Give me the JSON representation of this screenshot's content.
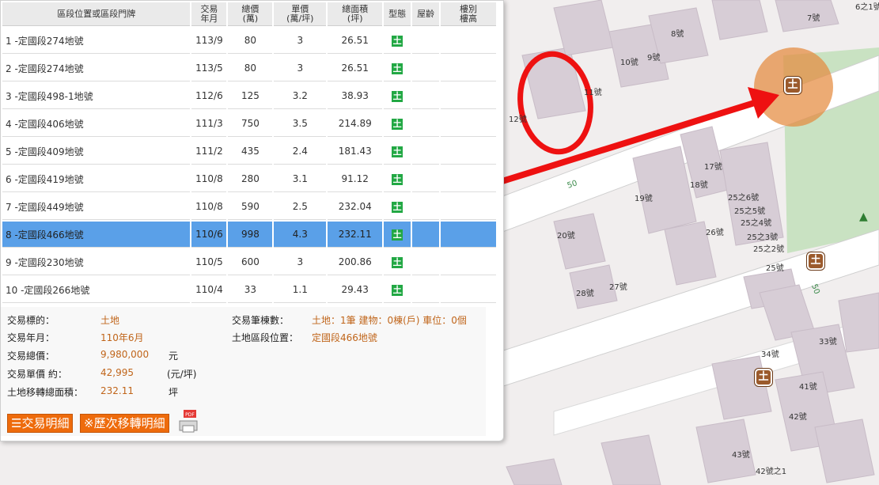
{
  "table": {
    "headers": {
      "addr": "區段位置或區段門牌",
      "date_l1": "交易",
      "date_l2": "年月",
      "price_l1": "總價",
      "price_l2": "(萬)",
      "unit_l1": "單價",
      "unit_l2": "(萬/坪)",
      "area_l1": "總面積",
      "area_l2": "(坪)",
      "type": "型態",
      "age": "屋齡",
      "floor_l1": "樓別",
      "floor_l2": "樓高"
    },
    "type_icon_glyph": "土",
    "rows": [
      {
        "addr": "1 -定國段274地號",
        "date": "113/9",
        "price": "80",
        "unit": "3",
        "area": "26.51"
      },
      {
        "addr": "2 -定國段274地號",
        "date": "113/5",
        "price": "80",
        "unit": "3",
        "area": "26.51"
      },
      {
        "addr": "3 -定國段498-1地號",
        "date": "112/6",
        "price": "125",
        "unit": "3.2",
        "area": "38.93"
      },
      {
        "addr": "4 -定國段406地號",
        "date": "111/3",
        "price": "750",
        "unit": "3.5",
        "area": "214.89"
      },
      {
        "addr": "5 -定國段409地號",
        "date": "111/2",
        "price": "435",
        "unit": "2.4",
        "area": "181.43"
      },
      {
        "addr": "6 -定國段419地號",
        "date": "110/8",
        "price": "280",
        "unit": "3.1",
        "area": "91.12"
      },
      {
        "addr": "7 -定國段449地號",
        "date": "110/8",
        "price": "590",
        "unit": "2.5",
        "area": "232.04"
      },
      {
        "addr": "8 -定國段466地號",
        "date": "110/6",
        "price": "998",
        "unit": "4.3",
        "area": "232.11"
      },
      {
        "addr": "9 -定國段230地號",
        "date": "110/5",
        "price": "600",
        "unit": "3",
        "area": "200.86"
      },
      {
        "addr": "10 -定國段266地號",
        "date": "110/4",
        "price": "33",
        "unit": "1.1",
        "area": "29.43"
      }
    ],
    "selected_row": 8
  },
  "detail": {
    "target_label": "交易標的：",
    "target_value": "土地",
    "ym_label": "交易年月：",
    "ym_value": "110年6月",
    "total_label": "交易總價：",
    "total_value": "9,980,000",
    "total_unit": "元",
    "unit_label": "交易單價 約：",
    "unit_value": "42,995",
    "unit_unit": "(元/坪)",
    "area_label": "土地移轉總面積：",
    "area_value": "232.11",
    "area_unit": "坪",
    "count_label": "交易筆棟數：",
    "count_value": "土地：1筆 建物：0棟(戶) 車位：0個",
    "location_label": "土地區段位置：",
    "location_value": "定國段466地號"
  },
  "buttons": {
    "detail_label": "交易明細",
    "history_label": "※歷次移轉明細",
    "pdf_badge": "PDF"
  },
  "map": {
    "marker_glyph": "土",
    "road_labels": [
      "50",
      "50"
    ],
    "house_numbers": [
      "6之1號",
      "7號",
      "8號",
      "9號",
      "10號",
      "11號",
      "12號",
      "17號",
      "18號",
      "19號",
      "20號",
      "25之6號",
      "25之5號",
      "25之4號",
      "25之3號",
      "25之2號",
      "25號",
      "26號",
      "27號",
      "28號",
      "33號",
      "34號",
      "41號",
      "42號",
      "43號",
      "42號之1"
    ]
  },
  "colors": {
    "selected_row": "#5aa0e8",
    "type_icon": "#22a844",
    "accent_button": "#ee6b0c",
    "value_text": "#c0651a",
    "annotation_red": "#ee1111",
    "marker": "#9b5a2c"
  }
}
